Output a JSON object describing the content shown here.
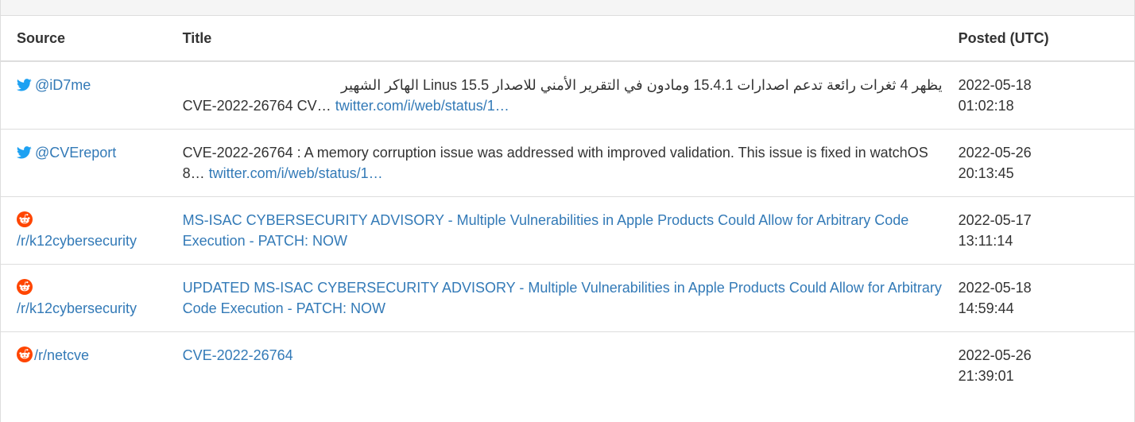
{
  "table": {
    "headers": {
      "source": "Source",
      "title": "Title",
      "posted": "Posted (UTC)"
    },
    "rows": [
      {
        "source_icon": "twitter-icon",
        "source": "@iD7me",
        "title_line1": "يظهر 4 ثغرات رائعة تدعم اصدارات 15.4.1 ومادون في التقرير الأمني للاصدار 15.5 Linus الهاكر الشهير",
        "title_text": "CVE-2022-26764 CV…",
        "title_link": "twitter.com/i/web/status/1…",
        "posted_date": "2022-05-18",
        "posted_time": "01:02:18"
      },
      {
        "source_icon": "twitter-icon",
        "source": "@CVEreport",
        "title_text": "CVE-2022-26764 : A memory corruption issue was addressed with improved validation. This issue is fixed in watchOS 8…",
        "title_link": "twitter.com/i/web/status/1…",
        "posted_date": "2022-05-26",
        "posted_time": "20:13:45"
      },
      {
        "source_icon": "reddit-icon",
        "source": "/r/k12cybersecurity",
        "title_link": "MS-ISAC CYBERSECURITY ADVISORY - Multiple Vulnerabilities in Apple Products Could Allow for Arbitrary Code Execution - PATCH: NOW",
        "posted_date": "2022-05-17",
        "posted_time": "13:11:14"
      },
      {
        "source_icon": "reddit-icon",
        "source": "/r/k12cybersecurity",
        "title_link": "UPDATED MS-ISAC CYBERSECURITY ADVISORY - Multiple Vulnerabilities in Apple Products Could Allow for Arbitrary Code Execution - PATCH: NOW",
        "posted_date": "2022-05-18",
        "posted_time": "14:59:44"
      },
      {
        "source_icon": "reddit-icon",
        "source": "/r/netcve",
        "title_link": "CVE-2022-26764",
        "posted_date": "2022-05-26",
        "posted_time": "21:39:01"
      }
    ]
  },
  "colors": {
    "link": "#337ab7",
    "text": "#333333",
    "twitter": "#1da1f2",
    "reddit": "#ff4500",
    "border": "#dddddd"
  }
}
